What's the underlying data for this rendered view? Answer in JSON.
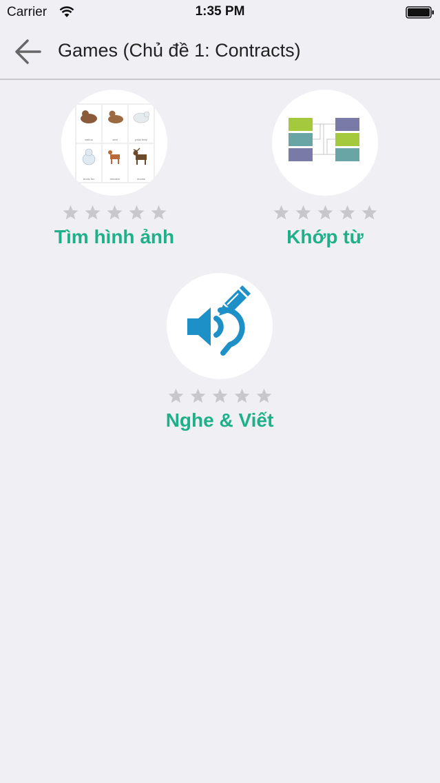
{
  "status_bar": {
    "carrier": "Carrier",
    "time": "1:35 PM"
  },
  "nav": {
    "title": "Games (Chủ đề 1: Contracts)"
  },
  "games": [
    {
      "label": "Tìm hình ảnh",
      "rating": 0,
      "max_rating": 5,
      "icon": "picture-grid-icon"
    },
    {
      "label": "Khớp từ",
      "rating": 0,
      "max_rating": 5,
      "icon": "matching-blocks-icon"
    },
    {
      "label": "Nghe & Viết",
      "rating": 0,
      "max_rating": 5,
      "icon": "listen-write-icon"
    }
  ],
  "colors": {
    "accent": "#1fb08a",
    "star": "#c7c7cc",
    "speaker": "#1e90c8",
    "block_green": "#a4c93c",
    "block_teal": "#6aa5a5",
    "block_purple": "#7a7aa8"
  }
}
